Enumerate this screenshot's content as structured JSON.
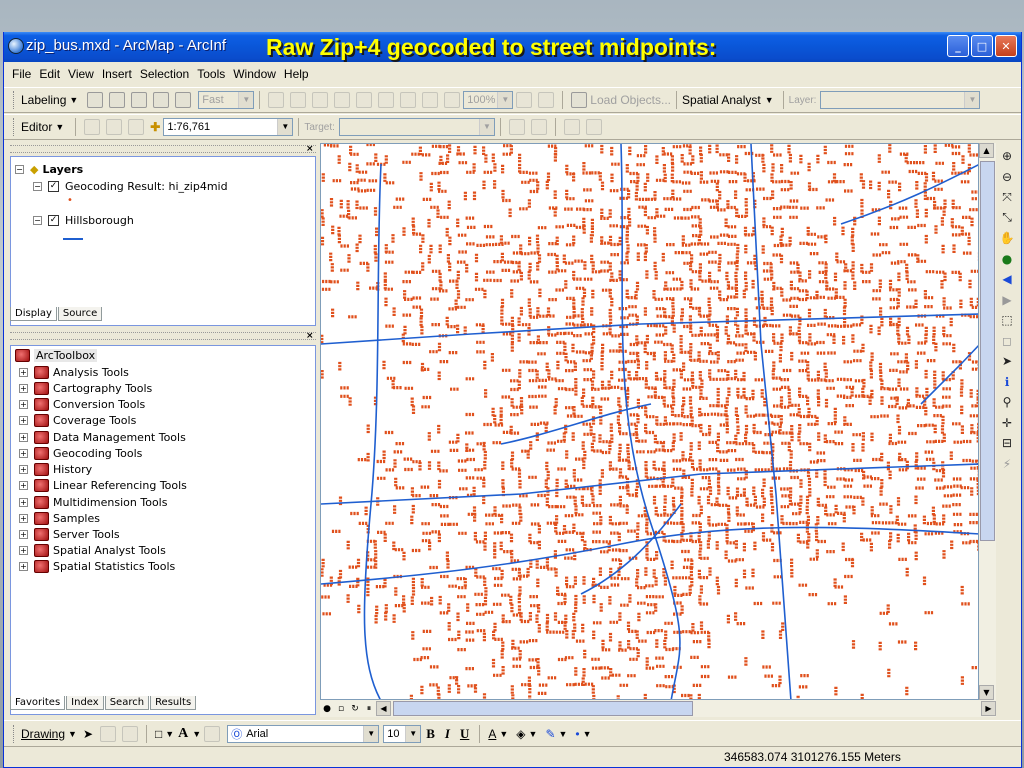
{
  "window": {
    "title": "zip_bus.mxd - ArcMap - ArcInfo",
    "title_visible": "zip_bus.mxd - ArcMap - ArcInf"
  },
  "overlay_caption": "Raw Zip+4 geocoded to street midpoints:",
  "menu": [
    "File",
    "Edit",
    "View",
    "Insert",
    "Selection",
    "Tools",
    "Window",
    "Help"
  ],
  "labeling_toolbar": {
    "label": "Labeling",
    "mode": "Fast",
    "zoom": "100%",
    "load_objects": "Load Objects...",
    "spatial_analyst": "Spatial Analyst",
    "layer_label": "Layer:"
  },
  "editor_toolbar": {
    "label": "Editor",
    "scale": "1:76,761",
    "target_label": "Target:"
  },
  "toc": {
    "root": "Layers",
    "layers": [
      {
        "name": "Geocoding Result: hi_zip4mid",
        "checked": true
      },
      {
        "name": "Hillsborough",
        "checked": true
      }
    ],
    "tabs": [
      "Display",
      "Source"
    ]
  },
  "toolbox": {
    "root": "ArcToolbox",
    "items": [
      "Analysis Tools",
      "Cartography Tools",
      "Conversion Tools",
      "Coverage Tools",
      "Data Management Tools",
      "Geocoding Tools",
      "History",
      "Linear Referencing Tools",
      "Multidimension Tools",
      "Samples",
      "Server Tools",
      "Spatial Analyst Tools",
      "Spatial Statistics Tools"
    ],
    "tabs": [
      "Favorites",
      "Index",
      "Search",
      "Results"
    ]
  },
  "draw_toolbar": {
    "label": "Drawing",
    "font": "Arial",
    "size": "10",
    "bold": "B",
    "italic": "I",
    "underline": "U"
  },
  "status": {
    "coords": "346583.074  3101276.155 Meters"
  },
  "colors": {
    "point_color": "#e0501c",
    "street_color": "#1f5fd0",
    "titlebar": "#0a56d8"
  }
}
